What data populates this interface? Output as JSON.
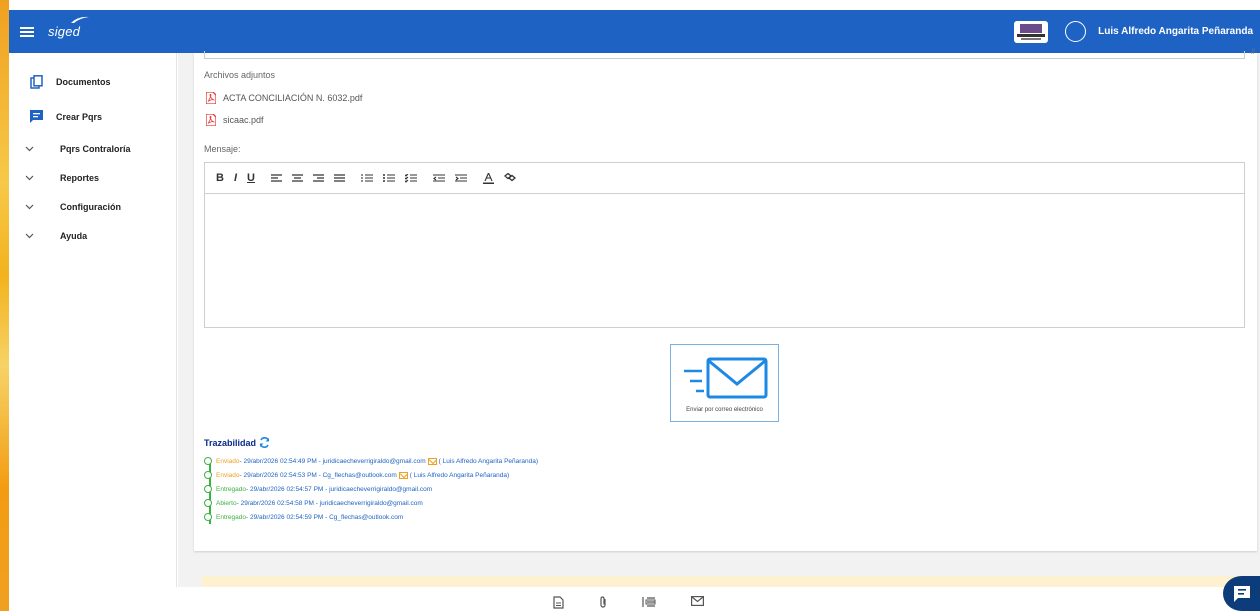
{
  "app": {
    "brand": "siged",
    "user_name": "Luis Alfredo Angarita Peñaranda"
  },
  "colors": {
    "primary": "#1e63c3",
    "success": "#3cb043",
    "warning": "#f0a020",
    "pdf": "#e53935"
  },
  "sidebar": {
    "items": [
      {
        "label": "Documentos",
        "icon": "documents-icon"
      },
      {
        "label": "Crear Pqrs",
        "icon": "chat-icon"
      },
      {
        "label": "Pqrs Contraloría",
        "icon": "chevron-down-icon"
      },
      {
        "label": "Reportes",
        "icon": "chevron-down-icon"
      },
      {
        "label": "Configuración",
        "icon": "chevron-down-icon"
      },
      {
        "label": "Ayuda",
        "icon": "chevron-down-icon"
      }
    ]
  },
  "attachments": {
    "label": "Archivos adjuntos",
    "files": [
      "ACTA CONCILIACIÓN N. 6032.pdf",
      "sicaac.pdf"
    ]
  },
  "message": {
    "label": "Mensaje:",
    "toolbar": [
      "B",
      "I",
      "U"
    ]
  },
  "send": {
    "label": "Enviar por correo electrónico"
  },
  "traceability": {
    "title": "Trazabilidad",
    "events": [
      {
        "status": "Enviado",
        "text": " - 29/abr/2026 02:54:49 PM - juridicaecheverrigiraldo@gmail.com",
        "by": "( Luis Alfredo Angarita Peñaranda)"
      },
      {
        "status": "Enviado",
        "text": " - 29/abr/2026 02:54:53 PM - Cg_flechas@outlook.com",
        "by": "( Luis Alfredo Angarita Peñaranda)"
      },
      {
        "status": "Entregado",
        "text": " - 29/abr/2026 02:54:57 PM - juridicaecheverrigiraldo@gmail.com",
        "by": ""
      },
      {
        "status": "Abierto",
        "text": " - 29/abr/2026 02:54:58 PM - juridicaecheverrigiraldo@gmail.com",
        "by": ""
      },
      {
        "status": "Entregado",
        "text": " - 29/abr/2026 02:54:59 PM - Cg_flechas@outlook.com",
        "by": ""
      }
    ]
  }
}
